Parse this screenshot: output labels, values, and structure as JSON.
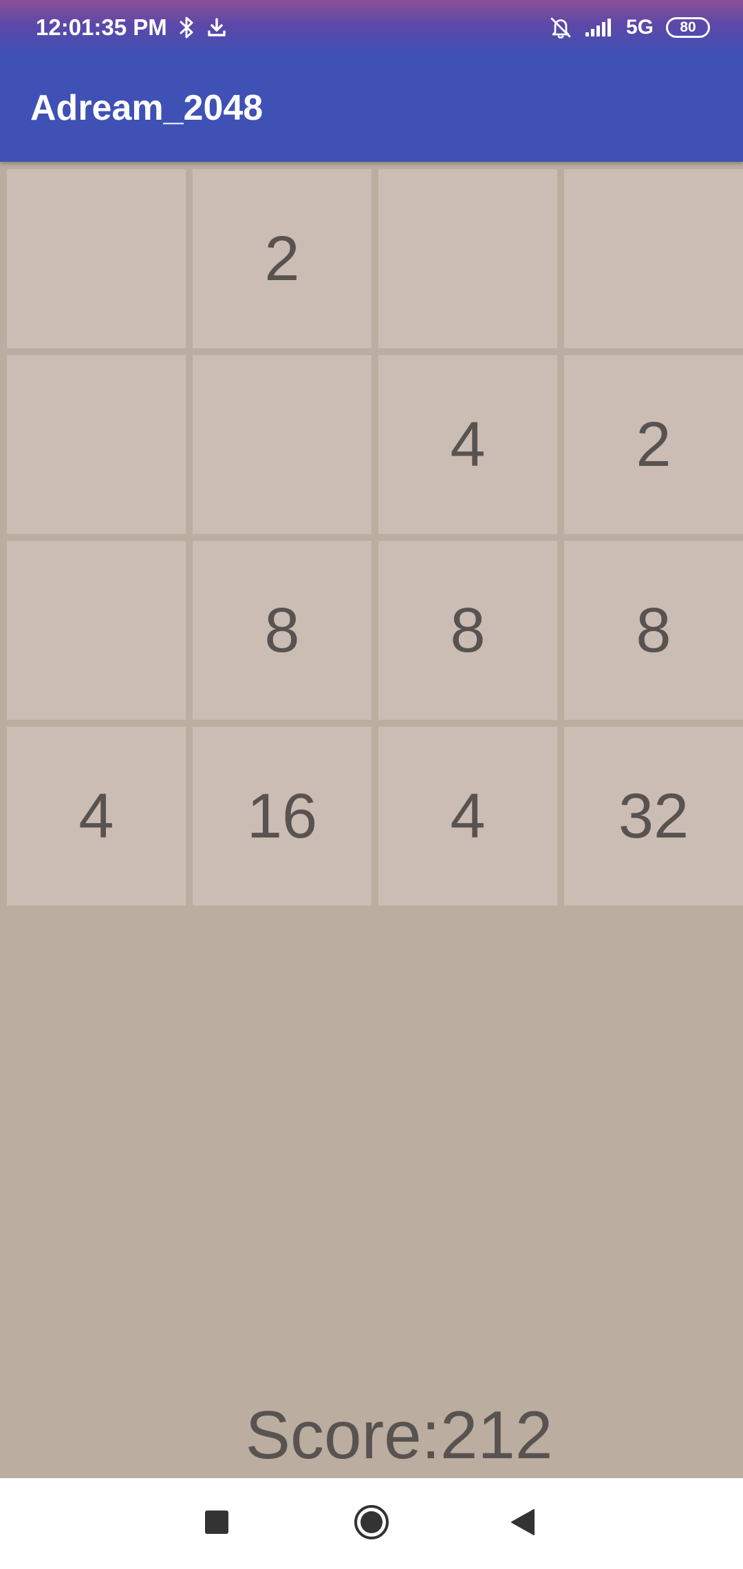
{
  "status_bar": {
    "time": "12:01:35 PM",
    "network": "5G",
    "battery": "80",
    "icons": [
      "bluetooth-icon",
      "download-icon",
      "bell-off-icon",
      "signal-icon",
      "battery-icon"
    ]
  },
  "app_bar": {
    "title": "Adream_2048",
    "color": "#3f51b5"
  },
  "board": {
    "tiles": [
      [
        "",
        "2",
        "",
        ""
      ],
      [
        "",
        "",
        "4",
        "2"
      ],
      [
        "",
        "8",
        "8",
        "8"
      ],
      [
        "4",
        "16",
        "4",
        "32"
      ]
    ],
    "tile_color": "#cbbdb3",
    "background_color": "#bbada0"
  },
  "score": {
    "text": "Score:212",
    "value": 212
  },
  "nav_bar": {
    "buttons": [
      "recents-icon",
      "home-icon",
      "back-icon"
    ]
  }
}
